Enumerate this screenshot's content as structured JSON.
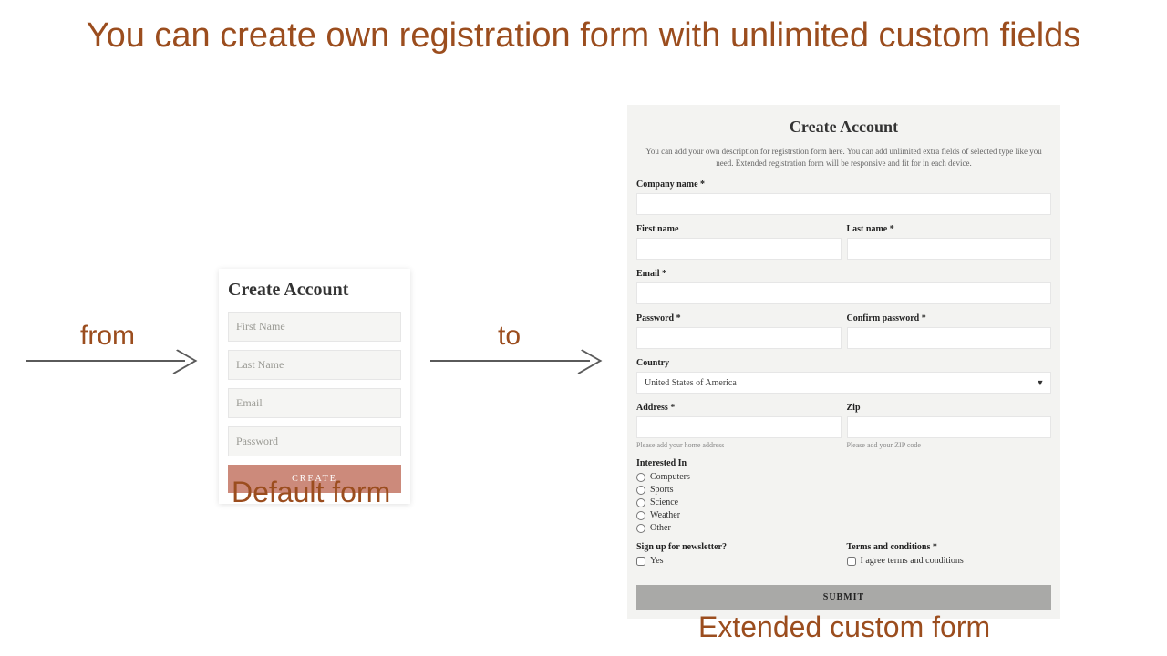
{
  "title": "You can create own registration form with unlimited custom fields",
  "labels": {
    "from": "from",
    "to": "to",
    "default_caption": "Default form",
    "extended_caption": "Extended custom form"
  },
  "default_form": {
    "heading": "Create Account",
    "placeholders": {
      "first_name": "First Name",
      "last_name": "Last Name",
      "email": "Email",
      "password": "Password"
    },
    "button": "CREATE"
  },
  "ext_form": {
    "heading": "Create Account",
    "description": "You can add your own description for registrstion form here. You can add unlimited extra fields of selected type like you need. Extended registration form will be responsive and fit for in each device.",
    "fields": {
      "company": "Company name *",
      "first_name": "First name",
      "last_name": "Last name *",
      "email": "Email *",
      "password": "Password *",
      "confirm_password": "Confirm password *",
      "country": "Country",
      "country_value": "United States of America",
      "address": "Address *",
      "address_hint": "Please add your home address",
      "zip": "Zip",
      "zip_hint": "Please add your ZIP code",
      "interested": "Interested In",
      "interests": [
        "Computers",
        "Sports",
        "Science",
        "Weather",
        "Other"
      ],
      "newsletter": "Sign up for newsletter?",
      "newsletter_option": "Yes",
      "terms": "Terms and conditions *",
      "terms_option": "I agree terms and conditions"
    },
    "button": "SUBMIT"
  }
}
